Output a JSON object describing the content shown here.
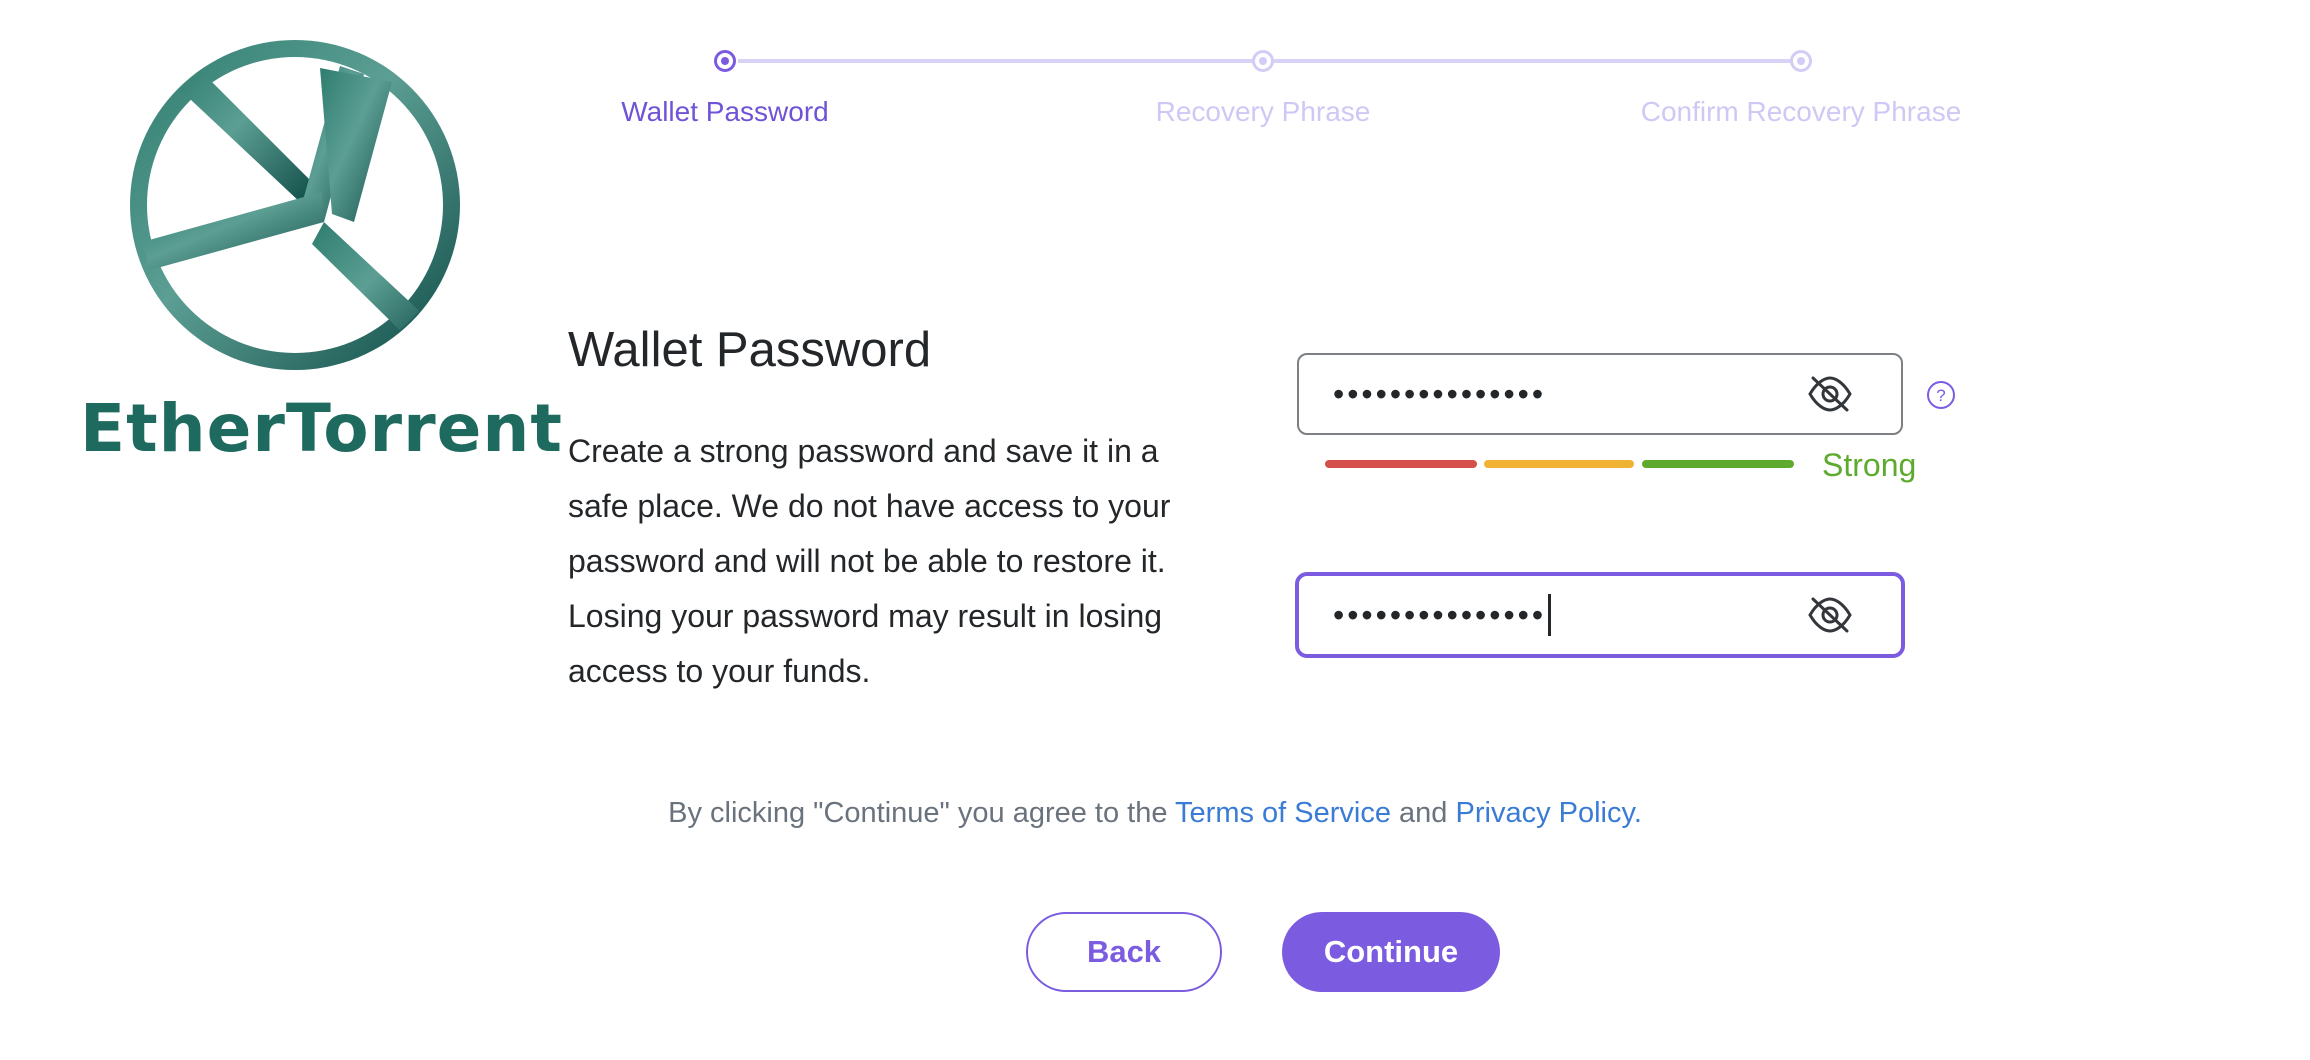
{
  "brand": {
    "name": "EtherTorrent"
  },
  "stepper": {
    "steps": [
      {
        "label": "Wallet Password",
        "active": true
      },
      {
        "label": "Recovery Phrase",
        "active": false
      },
      {
        "label": "Confirm Recovery Phrase",
        "active": false
      }
    ]
  },
  "section": {
    "title": "Wallet Password",
    "description": "Create a strong password and save it in a safe place. We do not have access to your password and will not be able to restore it. Losing your password may result in losing access to your funds."
  },
  "password": {
    "value": "•••••••••••••••",
    "strength": {
      "label": "Strong",
      "segments": 3,
      "segments_filled": 3
    },
    "icon": "eye-off-icon"
  },
  "confirm_password": {
    "value": "•••••••••••••••",
    "icon": "eye-off-icon"
  },
  "help": {
    "icon": "question-circle-icon"
  },
  "terms": {
    "prefix": "By clicking \"Continue\" you agree to the",
    "tos_link": "Terms of Service",
    "and": "and",
    "privacy_link": "Privacy Policy."
  },
  "buttons": {
    "back": "Back",
    "continue": "Continue"
  },
  "colors": {
    "accent": "#7b5ce1",
    "brand_teal": "#1f6a5e",
    "strength_red": "#d6504a",
    "strength_yellow": "#f0b233",
    "strength_green": "#5eaa2e",
    "link": "#3a7bd5"
  }
}
